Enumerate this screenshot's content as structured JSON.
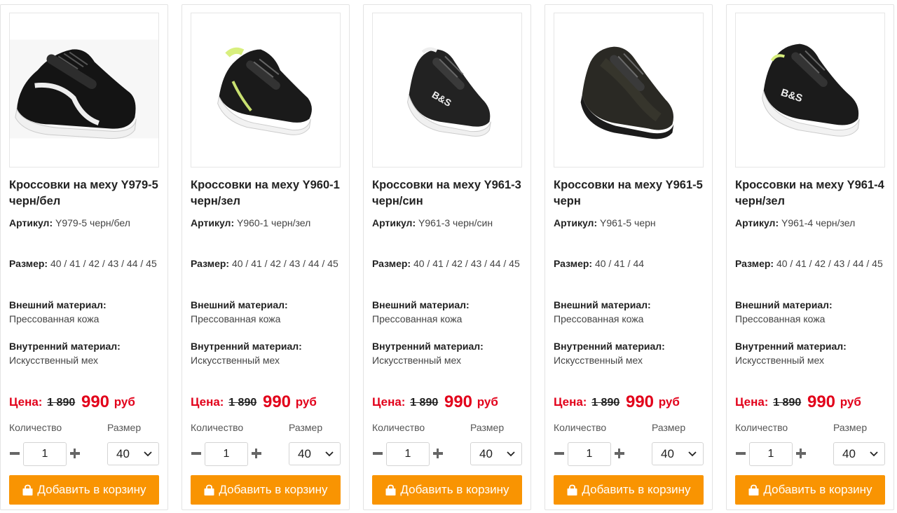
{
  "labels": {
    "article": "Артикул:",
    "size": "Размер:",
    "outer_material": "Внешний материал:",
    "inner_material": "Внутренний материал:",
    "price": "Цена:",
    "quantity": "Количество",
    "size_select": "Размер",
    "add_to_cart": "Добавить в корзину"
  },
  "colors": {
    "price_red": "#e2001a",
    "button_orange": "#f99402"
  },
  "icons": {
    "cart": "shopping-bag-icon",
    "minus": "minus-icon",
    "plus": "plus-icon",
    "select": "chevron-down-icon"
  },
  "products": [
    {
      "title": "Кроссовки на меху Y979-5 черн/бел",
      "article": "Y979-5 черн/бел",
      "sizes": "40 / 41 / 42 / 43 / 44 / 45",
      "outer_material": "Прессованная кожа",
      "inner_material": "Искусственный мех",
      "old_price": "1 890",
      "price": "990",
      "currency": "руб",
      "quantity": "1",
      "selected_size": "40"
    },
    {
      "title": "Кроссовки на меху Y960-1 черн/зел",
      "article": "Y960-1 черн/зел",
      "sizes": "40 / 41 / 42 / 43 / 44 / 45",
      "outer_material": "Прессованная кожа",
      "inner_material": "Искусственный мех",
      "old_price": "1 890",
      "price": "990",
      "currency": "руб",
      "quantity": "1",
      "selected_size": "40"
    },
    {
      "title": "Кроссовки на меху Y961-3 черн/син",
      "article": "Y961-3 черн/син",
      "sizes": "40 / 41 / 42 / 43 / 44 / 45",
      "outer_material": "Прессованная кожа",
      "inner_material": "Искусственный мех",
      "old_price": "1 890",
      "price": "990",
      "currency": "руб",
      "quantity": "1",
      "selected_size": "40"
    },
    {
      "title": "Кроссовки на меху Y961-5 черн",
      "article": "Y961-5 черн",
      "sizes": "40 / 41 / 44",
      "outer_material": "Прессованная кожа",
      "inner_material": "Искусственный мех",
      "old_price": "1 890",
      "price": "990",
      "currency": "руб",
      "quantity": "1",
      "selected_size": "40"
    },
    {
      "title": "Кроссовки на меху Y961-4 черн/зел",
      "article": "Y961-4 черн/зел",
      "sizes": "40 / 41 / 42 / 43 / 44 / 45",
      "outer_material": "Прессованная кожа",
      "inner_material": "Искусственный мех",
      "old_price": "1 890",
      "price": "990",
      "currency": "руб",
      "quantity": "1",
      "selected_size": "40"
    }
  ]
}
